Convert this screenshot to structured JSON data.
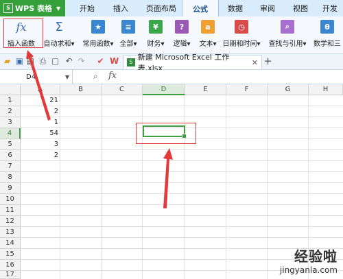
{
  "app": {
    "title": "WPS 表格"
  },
  "tabs": [
    {
      "label": "开始"
    },
    {
      "label": "插入"
    },
    {
      "label": "页面布局"
    },
    {
      "label": "公式"
    },
    {
      "label": "数据"
    },
    {
      "label": "审阅"
    },
    {
      "label": "视图"
    },
    {
      "label": "开发"
    }
  ],
  "ribbon": {
    "insert_function": "插入函数",
    "autosum": "自动求和",
    "common_functions": "常用函数",
    "all": "全部",
    "finance": "财务",
    "logic": "逻辑",
    "text": "文本",
    "datetime": "日期和时间",
    "lookup": "查找与引用",
    "math": "数学和三",
    "dropdown_caret": "▾"
  },
  "document": {
    "tab_title": "新建 Microsoft Excel 工作表.xlsx"
  },
  "name_box": {
    "value": "D4"
  },
  "formula_bar": {
    "fx": "fx"
  },
  "columns": [
    "A",
    "B",
    "C",
    "D",
    "E",
    "F",
    "G",
    "H"
  ],
  "rows": [
    "1",
    "2",
    "3",
    "4",
    "5",
    "6",
    "7",
    "8",
    "9",
    "10",
    "11",
    "12",
    "13",
    "14",
    "15",
    "16",
    "17"
  ],
  "column_a_values": [
    "21",
    "2",
    "1",
    "54",
    "3",
    "2"
  ],
  "selected_cell": "D4",
  "watermark": {
    "line1": "经验啦",
    "line2": "jingyanla.com"
  },
  "colors": {
    "accent_green": "#35a03a",
    "annotation_red": "#e23b3b",
    "selection_green": "#3f9e3f"
  }
}
